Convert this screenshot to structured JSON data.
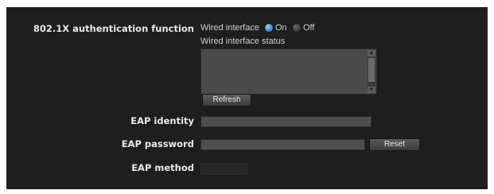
{
  "auth": {
    "label": "802.1X authentication function",
    "wired_interface": "Wired interface",
    "on_label": "On",
    "off_label": "Off",
    "selected": "On",
    "status_label": "Wired interface status",
    "status_text": "",
    "refresh_label": "Refresh"
  },
  "eap": {
    "identity_label": "EAP identity",
    "identity_value": "",
    "password_label": "EAP password",
    "password_value": "",
    "reset_label": "Reset",
    "method_label": "EAP method",
    "method_value": ""
  },
  "colors": {
    "panel_bg": "#1e1e1e",
    "radio_selected": "#3a8fe0"
  }
}
